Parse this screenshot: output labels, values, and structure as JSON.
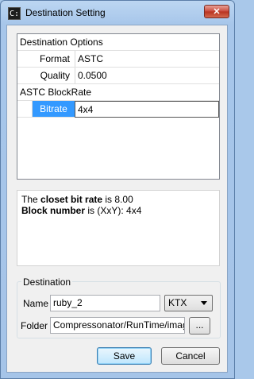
{
  "window": {
    "title": "Destination Setting",
    "icon_text": "C:",
    "close_label": "✕"
  },
  "properties": {
    "group1": "Destination Options",
    "format_label": "Format",
    "format_value": "ASTC",
    "quality_label": "Quality",
    "quality_value": "0.0500",
    "group2": "ASTC BlockRate",
    "bitrate_label": "Bitrate",
    "bitrate_value": "4x4"
  },
  "info": {
    "line1_prefix": "The ",
    "line1_bold": "closet bit rate",
    "line1_suffix": " is 8.00",
    "line2_bold": "Block number",
    "line2_suffix": " is (XxY): 4x4"
  },
  "destination": {
    "legend": "Destination",
    "name_label": "Name",
    "name_value": "ruby_2",
    "format_selected": "KTX",
    "folder_label": "Folder",
    "folder_value": "Compressonator/RunTime/images",
    "browse_label": "..."
  },
  "buttons": {
    "save": "Save",
    "cancel": "Cancel"
  },
  "colors": {
    "selection": "#3399ff",
    "frame": "#a9c8ea"
  },
  "icons": [
    "app-icon",
    "close-icon",
    "chevron-down-icon"
  ]
}
